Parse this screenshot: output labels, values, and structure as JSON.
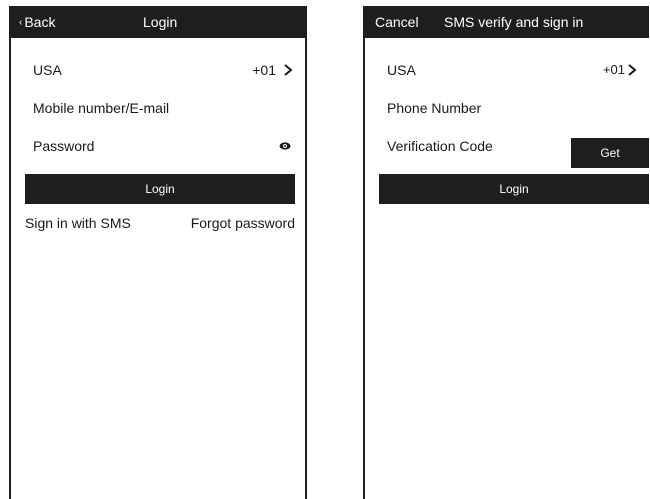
{
  "login_screen": {
    "back_label": "Back",
    "title": "Login",
    "country": "USA",
    "country_code": "+01",
    "username_placeholder": "Mobile number/E-mail",
    "password_placeholder": "Password",
    "login_label": "Login",
    "sms_link": "Sign in with SMS",
    "forgot_link": "Forgot password"
  },
  "sms_screen": {
    "cancel_label": "Cancel",
    "title": "SMS verify and sign in",
    "country": "USA",
    "country_code": "+01",
    "phone_placeholder": "Phone Number",
    "code_placeholder": "Verification Code",
    "get_label": "Get",
    "login_label": "Login"
  },
  "colors": {
    "bar": "#1e1e1e",
    "text": "#1a1a1a",
    "background": "#ffffff"
  },
  "icons": [
    "chevron-left-icon",
    "chevron-right-icon",
    "eye-icon"
  ]
}
